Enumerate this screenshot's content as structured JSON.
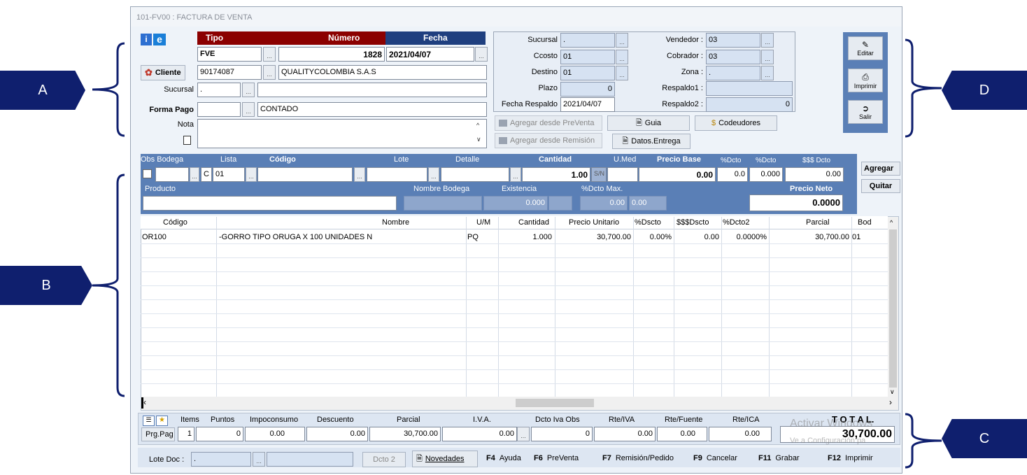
{
  "window": {
    "title": "101-FV00 : FACTURA DE VENTA"
  },
  "callouts": [
    "A",
    "B",
    "C",
    "D"
  ],
  "header": {
    "tipo_label": "Tipo",
    "numero_label": "Número",
    "fecha_label": "Fecha",
    "tipo_value": "FVE",
    "numero_value": "1828",
    "fecha_value": "2021/04/07",
    "cliente_button": "Cliente",
    "cliente_code": "90174087",
    "cliente_name": "QUALITYCOLOMBIA S.A.S",
    "sucursal_label": "Sucursal",
    "sucursal_value": ".",
    "forma_pago_label": "Forma Pago",
    "forma_pago_code": "01",
    "forma_pago_name": "CONTADO",
    "nota_label": "Nota"
  },
  "info_panel": {
    "sucursal_label": "Sucursal",
    "sucursal_value": ".",
    "ccosto_label": "Ccosto",
    "ccosto_value": "01",
    "destino_label": "Destino",
    "destino_value": "01",
    "plazo_label": "Plazo",
    "plazo_value": "0",
    "fecha_respaldo_label": "Fecha Respaldo",
    "fecha_respaldo_value": "2021/04/07",
    "vendedor_label": "Vendedor :",
    "vendedor_value": "03",
    "cobrador_label": "Cobrador :",
    "cobrador_value": "03",
    "zona_label": "Zona :",
    "zona_value": ".",
    "respaldo1_label": "Respaldo1 :",
    "respaldo1_value": "",
    "respaldo2_label": "Respaldo2 :",
    "respaldo2_value": "0"
  },
  "actions": {
    "agregar_preventa": "Agregar desde PreVenta",
    "agregar_remision": "Agregar desde Remisión",
    "guia": "Guia",
    "codeudores": "Codeudores",
    "datos_entrega": "Datos.Entrega"
  },
  "side_toolbar": {
    "editar": "Editar",
    "imprimir": "Imprimir",
    "salir": "Salir"
  },
  "entry": {
    "obs_bodega_label": "Obs Bodega",
    "lista_label": "Lista",
    "codigo_label": "Código",
    "lote_label": "Lote",
    "detalle_label": "Detalle",
    "cantidad_label": "Cantidad",
    "umed_label": "U.Med",
    "precio_base_label": "Precio Base",
    "pdcto1_label": "%Dcto",
    "pdcto2_label": "%Dcto",
    "sdcto_label": "$$$ Dcto",
    "c_value": "C",
    "lista_value": "01",
    "cantidad_value": "1.00",
    "sn_value": "S/N",
    "precio_base_value": "0.00",
    "pdcto1_value": "0.0",
    "pdcto2_value": "0.000",
    "sdcto_value": "0.00",
    "producto_label": "Producto",
    "nombre_bodega_label": "Nombre Bodega",
    "existencia_label": "Existencia",
    "dcto_max_label": "%Dcto Max.",
    "precio_neto_label": "Precio Neto",
    "existencia_value": "0.000",
    "dcto_max_value1": "0.00",
    "dcto_max_value2": "0.00",
    "precio_neto_value": "0.0000",
    "agregar_button": "Agregar",
    "quitar_button": "Quitar"
  },
  "grid": {
    "columns": [
      "Código",
      "Nombre",
      "U/M",
      "Cantidad",
      "Precio Unitario",
      "%Dscto",
      "$$$Dscto",
      "%Dcto2",
      "Parcial",
      "Bod"
    ],
    "rows": [
      [
        "OR100",
        "-GORRO TIPO ORUGA X 100 UNIDADES N",
        "PQ",
        "1.000",
        "30,700.00",
        "0.00%",
        "0.00",
        "0.0000%",
        "30,700.00",
        "01"
      ]
    ]
  },
  "totals": {
    "items_label": "Items",
    "puntos_label": "Puntos",
    "impoconsumo_label": "Impoconsumo",
    "descuento_label": "Descuento",
    "parcial_label": "Parcial",
    "iva_label": "I.V.A.",
    "dcto_iva_obs_label": "Dcto Iva Obs",
    "rte_iva_label": "Rte/IVA",
    "rte_fuente_label": "Rte/Fuente",
    "rte_ica_label": "Rte/ICA",
    "total_label": "T O T A L.",
    "prg_pag": "Prg.Pag",
    "items_value": "1",
    "puntos_value": "0",
    "impoconsumo_value": "0.00",
    "descuento_value": "0.00",
    "parcial_value": "30,700.00",
    "iva_value": "0.00",
    "dcto_iva_obs_value": "0",
    "rte_iva_value": "0.00",
    "rte_fuente_value": "0.00",
    "rte_ica_value": "0.00",
    "total_value": "30,700.00"
  },
  "footer": {
    "lote_doc_label": "Lote Doc :",
    "lote_doc_value": ".",
    "dcto2": "Dcto 2",
    "novedades": "Novedades",
    "f4_key": "F4",
    "f4_label": "Ayuda",
    "f6_key": "F6",
    "f6_label": "PreVenta",
    "f7_key": "F7",
    "f7_label": "Remisión/Pedido",
    "f9_key": "F9",
    "f9_label": "Cancelar",
    "f11_key": "F11",
    "f11_label": "Grabar",
    "f12_key": "F12",
    "f12_label": "Imprimir"
  },
  "watermark": {
    "line1": "Activar Windows",
    "line2": "Ve a Configuración pa"
  },
  "colors": {
    "callout": "#0f1f6e",
    "panel_blue": "#5a7fb6",
    "header_red": "#8b0000",
    "header_blue": "#1f3f7f"
  }
}
